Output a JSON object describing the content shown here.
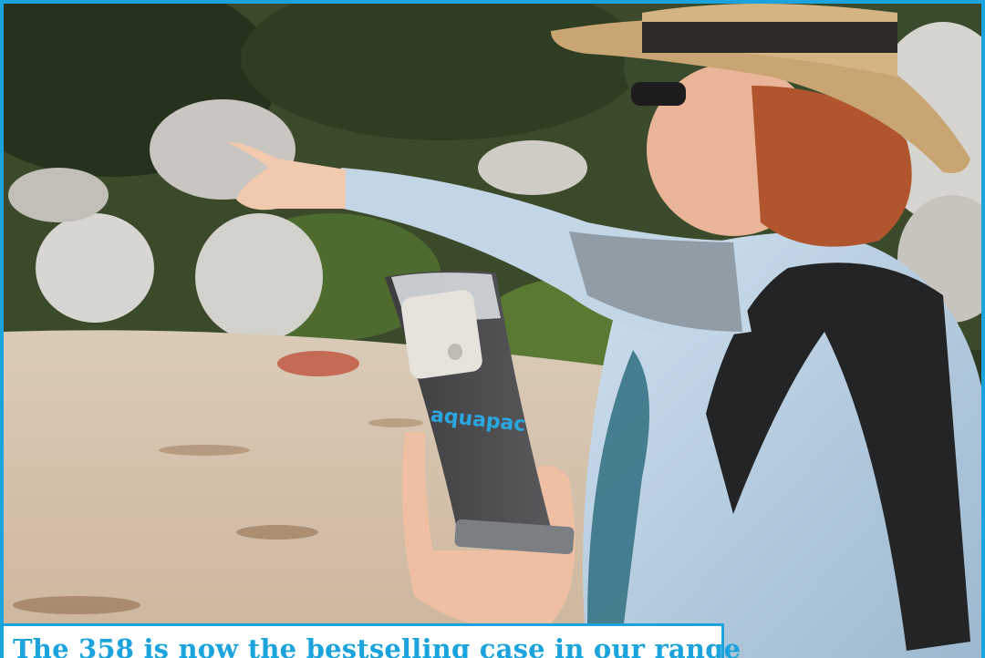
{
  "caption": {
    "text": "The 358 is now the bestselling case in our range"
  },
  "photo": {
    "case_brand": "aquapac"
  },
  "colors": {
    "accent": "#1aa3dc"
  }
}
